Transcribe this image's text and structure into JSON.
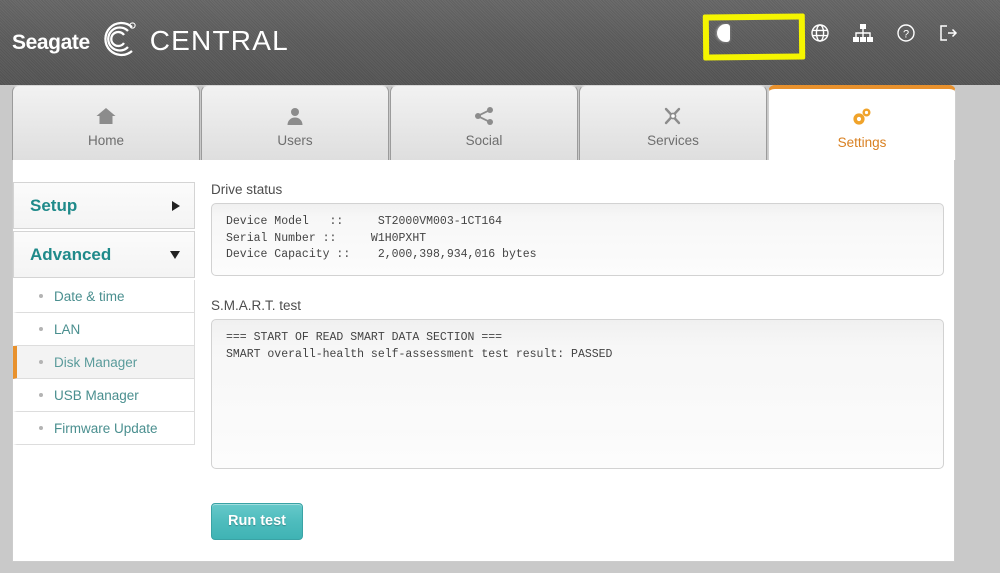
{
  "header": {
    "brand_name": "Seagate",
    "brand_mark": "seagate-swirl-logo",
    "product": "CENTRAL",
    "toggle": {
      "name": "power-toggle",
      "state": "on"
    },
    "icons": [
      {
        "name": "globe-icon",
        "label": "Language"
      },
      {
        "name": "network-icon",
        "label": "Network"
      },
      {
        "name": "help-icon",
        "label": "Help"
      },
      {
        "name": "logout-icon",
        "label": "Sign out"
      }
    ],
    "highlight": {
      "name": "yellow-annotation-box",
      "color": "#f5f500"
    }
  },
  "tabs": [
    {
      "label": "Home",
      "icon": "home-icon",
      "active": false
    },
    {
      "label": "Users",
      "icon": "user-icon",
      "active": false
    },
    {
      "label": "Social",
      "icon": "share-icon",
      "active": false
    },
    {
      "label": "Services",
      "icon": "tools-icon",
      "active": false
    },
    {
      "label": "Settings",
      "icon": "gears-icon",
      "active": true
    }
  ],
  "sidebar": {
    "groups": [
      {
        "label": "Setup",
        "expanded": false,
        "arrow": "chevron-right-icon"
      },
      {
        "label": "Advanced",
        "expanded": true,
        "arrow": "chevron-down-icon"
      }
    ],
    "items": [
      {
        "label": "Date & time",
        "active": false
      },
      {
        "label": "LAN",
        "active": false
      },
      {
        "label": "Disk Manager",
        "active": true
      },
      {
        "label": "USB Manager",
        "active": false
      },
      {
        "label": "Firmware Update",
        "active": false
      }
    ]
  },
  "main": {
    "drive_status": {
      "label": "Drive status",
      "text": "Device Model   ::     ST2000VM003-1CT164\nSerial Number ::     W1H0PXHT\nDevice Capacity ::    2,000,398,934,016 bytes"
    },
    "smart_test": {
      "label": "S.M.A.R.T. test",
      "text": "=== START OF READ SMART DATA SECTION ===\nSMART overall-health self-assessment test result: PASSED"
    },
    "run_button": "Run test"
  },
  "colors": {
    "accent_orange": "#e8912d",
    "teal": "#1f8a8a",
    "button_teal": "#4ebcbd",
    "header_gray": "#5c5c5c",
    "highlight_yellow": "#f5f500"
  }
}
